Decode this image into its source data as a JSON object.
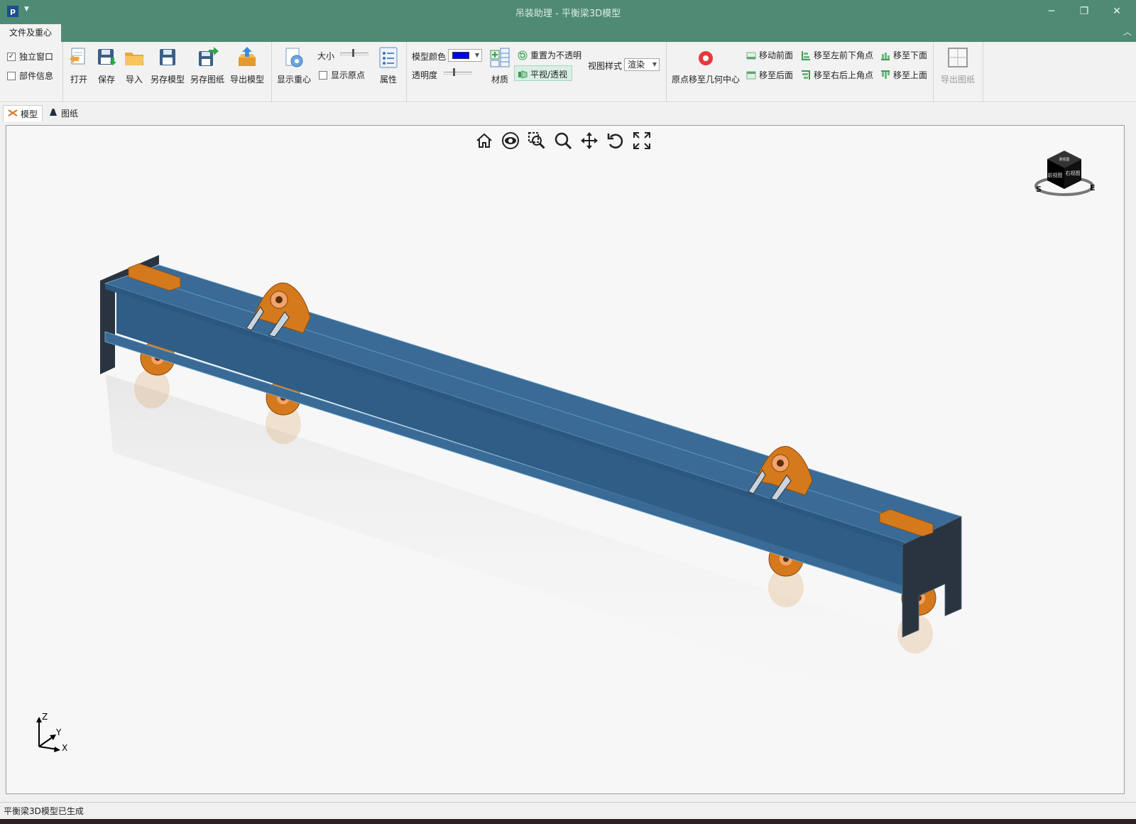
{
  "window": {
    "app_icon_letter": "p",
    "title": "吊装助理 - 平衡梁3D模型",
    "minimize_glyph": "─",
    "restore_glyph": "❐",
    "close_glyph": "✕"
  },
  "ribbon_tab": {
    "label": "文件及重心"
  },
  "options": {
    "standalone_window": {
      "label": "独立窗口",
      "checked": true
    },
    "part_info": {
      "label": "部件信息",
      "checked": false
    }
  },
  "file_group": {
    "open": "打开",
    "save": "保存",
    "import": "导入",
    "save_model_as": "另存模型",
    "save_drawing_as": "另存图纸",
    "export_model": "导出模型"
  },
  "cog_group": {
    "show_cog": "显示重心",
    "size_label": "大小",
    "size_level": 0.45,
    "show_origin": {
      "label": "显示原点",
      "checked": false
    },
    "properties": "属性"
  },
  "appearance_group": {
    "model_color_label": "模型颜色",
    "model_color": "#0000ff",
    "transparency_label": "透明度",
    "transparency_level": 0.35,
    "material": "材质",
    "reset_opaque": "重置为不透明",
    "ortho_persp": "平视/透视",
    "view_style_label": "视图样式",
    "view_style_value": "渲染"
  },
  "origin_group": {
    "move_origin_center": "原点移至几何中心",
    "move_front": "移动前面",
    "move_back": "移至后面",
    "move_front_left_bottom": "移至左前下角点",
    "move_back_right_top": "移至右后上角点",
    "move_bottom": "移至下面",
    "move_top": "移至上面"
  },
  "export_group": {
    "export_drawing": "导出图纸"
  },
  "doc_tabs": [
    {
      "label": "模型",
      "active": true
    },
    {
      "label": "图纸",
      "active": false
    }
  ],
  "viewcube": {
    "face_top": "俯视图",
    "face_front": "前视图",
    "face_right": "右视图",
    "compass_s": "S",
    "compass_e": "E"
  },
  "axes": {
    "z": "Z",
    "y": "Y",
    "x": "X"
  },
  "colors": {
    "titlebar": "#4f8a75",
    "beam_top": "#3a6b96",
    "beam_web": "#2f5d86",
    "beam_end": "#2a343f",
    "lug": "#d4791c"
  },
  "status": {
    "text": "平衡梁3D模型已生成"
  }
}
